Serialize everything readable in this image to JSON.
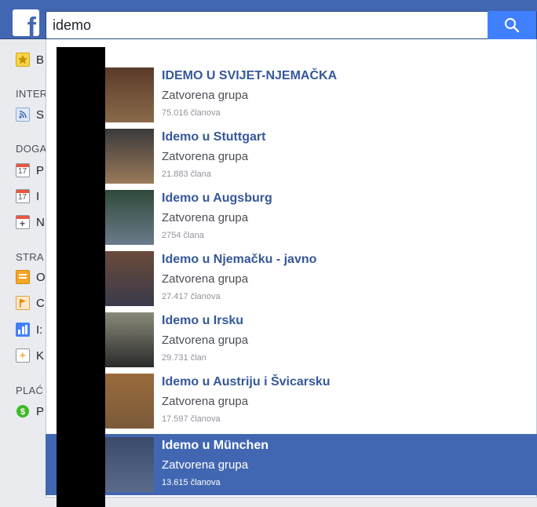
{
  "search": {
    "query": "idemo"
  },
  "sidebar": {
    "items_top": [
      {
        "label": "B",
        "icon": "star-icon"
      }
    ],
    "sections": [
      {
        "heading": "INTER",
        "items": [
          {
            "label": "S",
            "icon": "rss-icon"
          }
        ]
      },
      {
        "heading": "DOGA",
        "items": [
          {
            "label": "P",
            "icon": "calendar-icon"
          },
          {
            "label": "I",
            "icon": "calendar-icon"
          },
          {
            "label": "N",
            "icon": "calendar-add-icon"
          }
        ]
      },
      {
        "heading": "STRA",
        "items": [
          {
            "label": "O",
            "icon": "page-icon"
          },
          {
            "label": "C",
            "icon": "flag-icon"
          },
          {
            "label": "I:",
            "icon": "insights-icon"
          },
          {
            "label": "K",
            "icon": "create-page-icon"
          }
        ]
      },
      {
        "heading": "PLAĆ",
        "items": [
          {
            "label": "P",
            "icon": "payments-icon"
          }
        ]
      }
    ]
  },
  "results": [
    {
      "title": "IDEMO U SVIJET-NJEMAČKA",
      "type": "Zatvorena grupa",
      "members": "75.016 članova",
      "selected": false
    },
    {
      "title": "Idemo u Stuttgart",
      "type": "Zatvorena grupa",
      "members": "21.883 člana",
      "selected": false
    },
    {
      "title": "Idemo u Augsburg",
      "type": "Zatvorena grupa",
      "members": "2754 člana",
      "selected": false
    },
    {
      "title": "Idemo u Njemačku - javno",
      "type": "Zatvorena grupa",
      "members": "27.417 članova",
      "selected": false
    },
    {
      "title": "Idemo u Irsku",
      "type": "Zatvorena grupa",
      "members": "29.731 član",
      "selected": false
    },
    {
      "title": "Idemo u Austriju i Švicarsku",
      "type": "Zatvorena grupa",
      "members": "17.597 članova",
      "selected": false
    },
    {
      "title": "Idemo u München",
      "type": "Zatvorena grupa",
      "members": "13.615 članova",
      "selected": true
    }
  ],
  "colors": {
    "brand": "#4267b2",
    "search_button": "#4080ff",
    "link": "#365899",
    "selected_bg": "#4267b2"
  }
}
